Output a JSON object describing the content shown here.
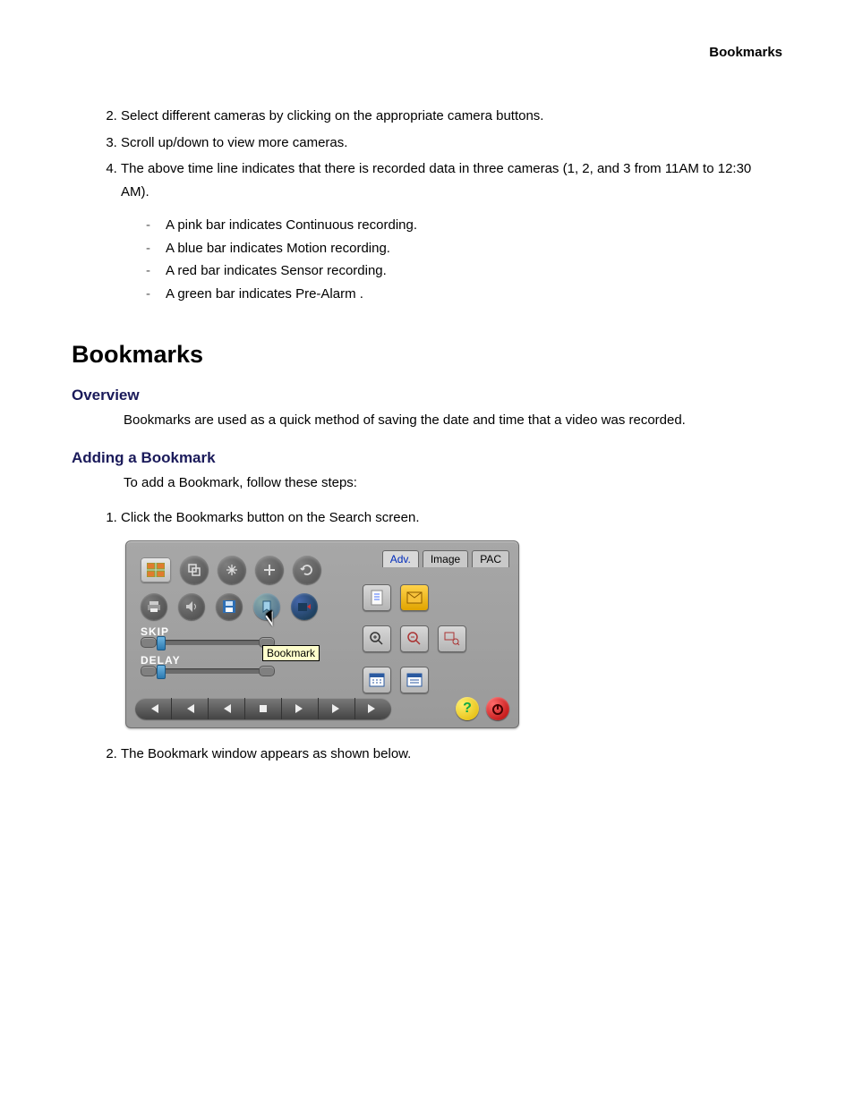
{
  "header": {
    "right": "Bookmarks"
  },
  "list_start": 2,
  "list_items": [
    "Select different cameras by clicking on the appropriate camera buttons.",
    "Scroll up/down to view more cameras.",
    "The above time line indicates that there is recorded data in three cameras (1, 2, and 3 from 11AM to 12:30 AM)."
  ],
  "sub_list": [
    "A pink bar indicates Continuous recording.",
    "A blue bar indicates Motion recording.",
    "A red bar indicates Sensor recording.",
    "A green bar indicates Pre-Alarm ."
  ],
  "section_title": "Bookmarks",
  "overview": {
    "heading": "Overview",
    "text": "Bookmarks are used as a quick method of saving the date and time that a video was recorded."
  },
  "adding": {
    "heading": "Adding a Bookmark",
    "intro": "To add a Bookmark, follow these steps:",
    "steps": [
      "Click the Bookmarks button on the Search screen.",
      "The Bookmark window appears as shown below."
    ]
  },
  "ui": {
    "tabs": [
      "Adv.",
      "Image",
      "PAC"
    ],
    "tooltip": "Bookmark",
    "skip_label": "SKIP",
    "delay_label": "DELAY",
    "help_glyph": "?",
    "power_glyph": "⏻"
  }
}
